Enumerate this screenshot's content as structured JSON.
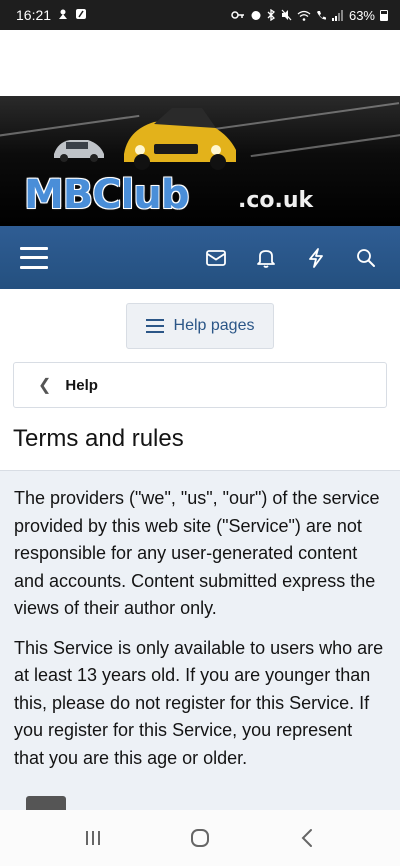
{
  "status_bar": {
    "time": "16:21",
    "battery": "63%"
  },
  "banner": {
    "logo_main": "MBClub",
    "logo_suffix": ".co.uk"
  },
  "navbar": {
    "icons": [
      "menu-icon",
      "mail-icon",
      "bell-icon",
      "bolt-icon",
      "search-icon"
    ]
  },
  "help_button": {
    "label": "Help pages"
  },
  "breadcrumb": {
    "label": "Help"
  },
  "page": {
    "title": "Terms and rules",
    "paragraphs": [
      "The providers (\"we\", \"us\", \"our\") of the service provided by this web site (\"Service\") are not responsible for any user-generated content and accounts. Content submitted express the views of their author only.",
      "This Service is only available to users who are at least 13 years old. If you are younger than this, please do not register for this Service. If you register for this Service, you represent that you are this age or older."
    ]
  },
  "colors": {
    "navbar": "#2f5d94",
    "link": "#2b5687",
    "content_bg": "#edf1f6"
  }
}
